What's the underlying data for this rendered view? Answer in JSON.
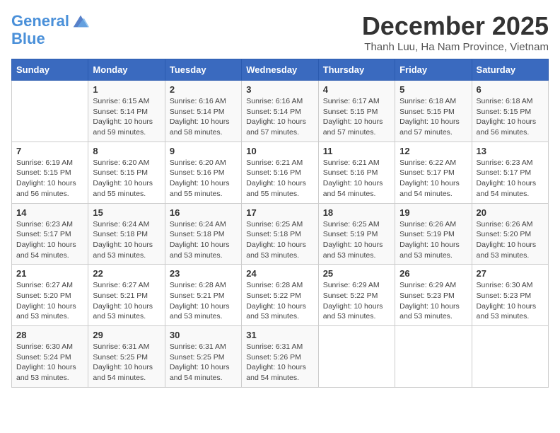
{
  "header": {
    "logo_line1": "General",
    "logo_line2": "Blue",
    "month": "December 2025",
    "location": "Thanh Luu, Ha Nam Province, Vietnam"
  },
  "days_of_week": [
    "Sunday",
    "Monday",
    "Tuesday",
    "Wednesday",
    "Thursday",
    "Friday",
    "Saturday"
  ],
  "weeks": [
    [
      {
        "num": "",
        "info": ""
      },
      {
        "num": "1",
        "info": "Sunrise: 6:15 AM\nSunset: 5:14 PM\nDaylight: 10 hours\nand 59 minutes."
      },
      {
        "num": "2",
        "info": "Sunrise: 6:16 AM\nSunset: 5:14 PM\nDaylight: 10 hours\nand 58 minutes."
      },
      {
        "num": "3",
        "info": "Sunrise: 6:16 AM\nSunset: 5:14 PM\nDaylight: 10 hours\nand 57 minutes."
      },
      {
        "num": "4",
        "info": "Sunrise: 6:17 AM\nSunset: 5:15 PM\nDaylight: 10 hours\nand 57 minutes."
      },
      {
        "num": "5",
        "info": "Sunrise: 6:18 AM\nSunset: 5:15 PM\nDaylight: 10 hours\nand 57 minutes."
      },
      {
        "num": "6",
        "info": "Sunrise: 6:18 AM\nSunset: 5:15 PM\nDaylight: 10 hours\nand 56 minutes."
      }
    ],
    [
      {
        "num": "7",
        "info": "Sunrise: 6:19 AM\nSunset: 5:15 PM\nDaylight: 10 hours\nand 56 minutes."
      },
      {
        "num": "8",
        "info": "Sunrise: 6:20 AM\nSunset: 5:15 PM\nDaylight: 10 hours\nand 55 minutes."
      },
      {
        "num": "9",
        "info": "Sunrise: 6:20 AM\nSunset: 5:16 PM\nDaylight: 10 hours\nand 55 minutes."
      },
      {
        "num": "10",
        "info": "Sunrise: 6:21 AM\nSunset: 5:16 PM\nDaylight: 10 hours\nand 55 minutes."
      },
      {
        "num": "11",
        "info": "Sunrise: 6:21 AM\nSunset: 5:16 PM\nDaylight: 10 hours\nand 54 minutes."
      },
      {
        "num": "12",
        "info": "Sunrise: 6:22 AM\nSunset: 5:17 PM\nDaylight: 10 hours\nand 54 minutes."
      },
      {
        "num": "13",
        "info": "Sunrise: 6:23 AM\nSunset: 5:17 PM\nDaylight: 10 hours\nand 54 minutes."
      }
    ],
    [
      {
        "num": "14",
        "info": "Sunrise: 6:23 AM\nSunset: 5:17 PM\nDaylight: 10 hours\nand 54 minutes."
      },
      {
        "num": "15",
        "info": "Sunrise: 6:24 AM\nSunset: 5:18 PM\nDaylight: 10 hours\nand 53 minutes."
      },
      {
        "num": "16",
        "info": "Sunrise: 6:24 AM\nSunset: 5:18 PM\nDaylight: 10 hours\nand 53 minutes."
      },
      {
        "num": "17",
        "info": "Sunrise: 6:25 AM\nSunset: 5:18 PM\nDaylight: 10 hours\nand 53 minutes."
      },
      {
        "num": "18",
        "info": "Sunrise: 6:25 AM\nSunset: 5:19 PM\nDaylight: 10 hours\nand 53 minutes."
      },
      {
        "num": "19",
        "info": "Sunrise: 6:26 AM\nSunset: 5:19 PM\nDaylight: 10 hours\nand 53 minutes."
      },
      {
        "num": "20",
        "info": "Sunrise: 6:26 AM\nSunset: 5:20 PM\nDaylight: 10 hours\nand 53 minutes."
      }
    ],
    [
      {
        "num": "21",
        "info": "Sunrise: 6:27 AM\nSunset: 5:20 PM\nDaylight: 10 hours\nand 53 minutes."
      },
      {
        "num": "22",
        "info": "Sunrise: 6:27 AM\nSunset: 5:21 PM\nDaylight: 10 hours\nand 53 minutes."
      },
      {
        "num": "23",
        "info": "Sunrise: 6:28 AM\nSunset: 5:21 PM\nDaylight: 10 hours\nand 53 minutes."
      },
      {
        "num": "24",
        "info": "Sunrise: 6:28 AM\nSunset: 5:22 PM\nDaylight: 10 hours\nand 53 minutes."
      },
      {
        "num": "25",
        "info": "Sunrise: 6:29 AM\nSunset: 5:22 PM\nDaylight: 10 hours\nand 53 minutes."
      },
      {
        "num": "26",
        "info": "Sunrise: 6:29 AM\nSunset: 5:23 PM\nDaylight: 10 hours\nand 53 minutes."
      },
      {
        "num": "27",
        "info": "Sunrise: 6:30 AM\nSunset: 5:23 PM\nDaylight: 10 hours\nand 53 minutes."
      }
    ],
    [
      {
        "num": "28",
        "info": "Sunrise: 6:30 AM\nSunset: 5:24 PM\nDaylight: 10 hours\nand 53 minutes."
      },
      {
        "num": "29",
        "info": "Sunrise: 6:31 AM\nSunset: 5:25 PM\nDaylight: 10 hours\nand 54 minutes."
      },
      {
        "num": "30",
        "info": "Sunrise: 6:31 AM\nSunset: 5:25 PM\nDaylight: 10 hours\nand 54 minutes."
      },
      {
        "num": "31",
        "info": "Sunrise: 6:31 AM\nSunset: 5:26 PM\nDaylight: 10 hours\nand 54 minutes."
      },
      {
        "num": "",
        "info": ""
      },
      {
        "num": "",
        "info": ""
      },
      {
        "num": "",
        "info": ""
      }
    ]
  ]
}
